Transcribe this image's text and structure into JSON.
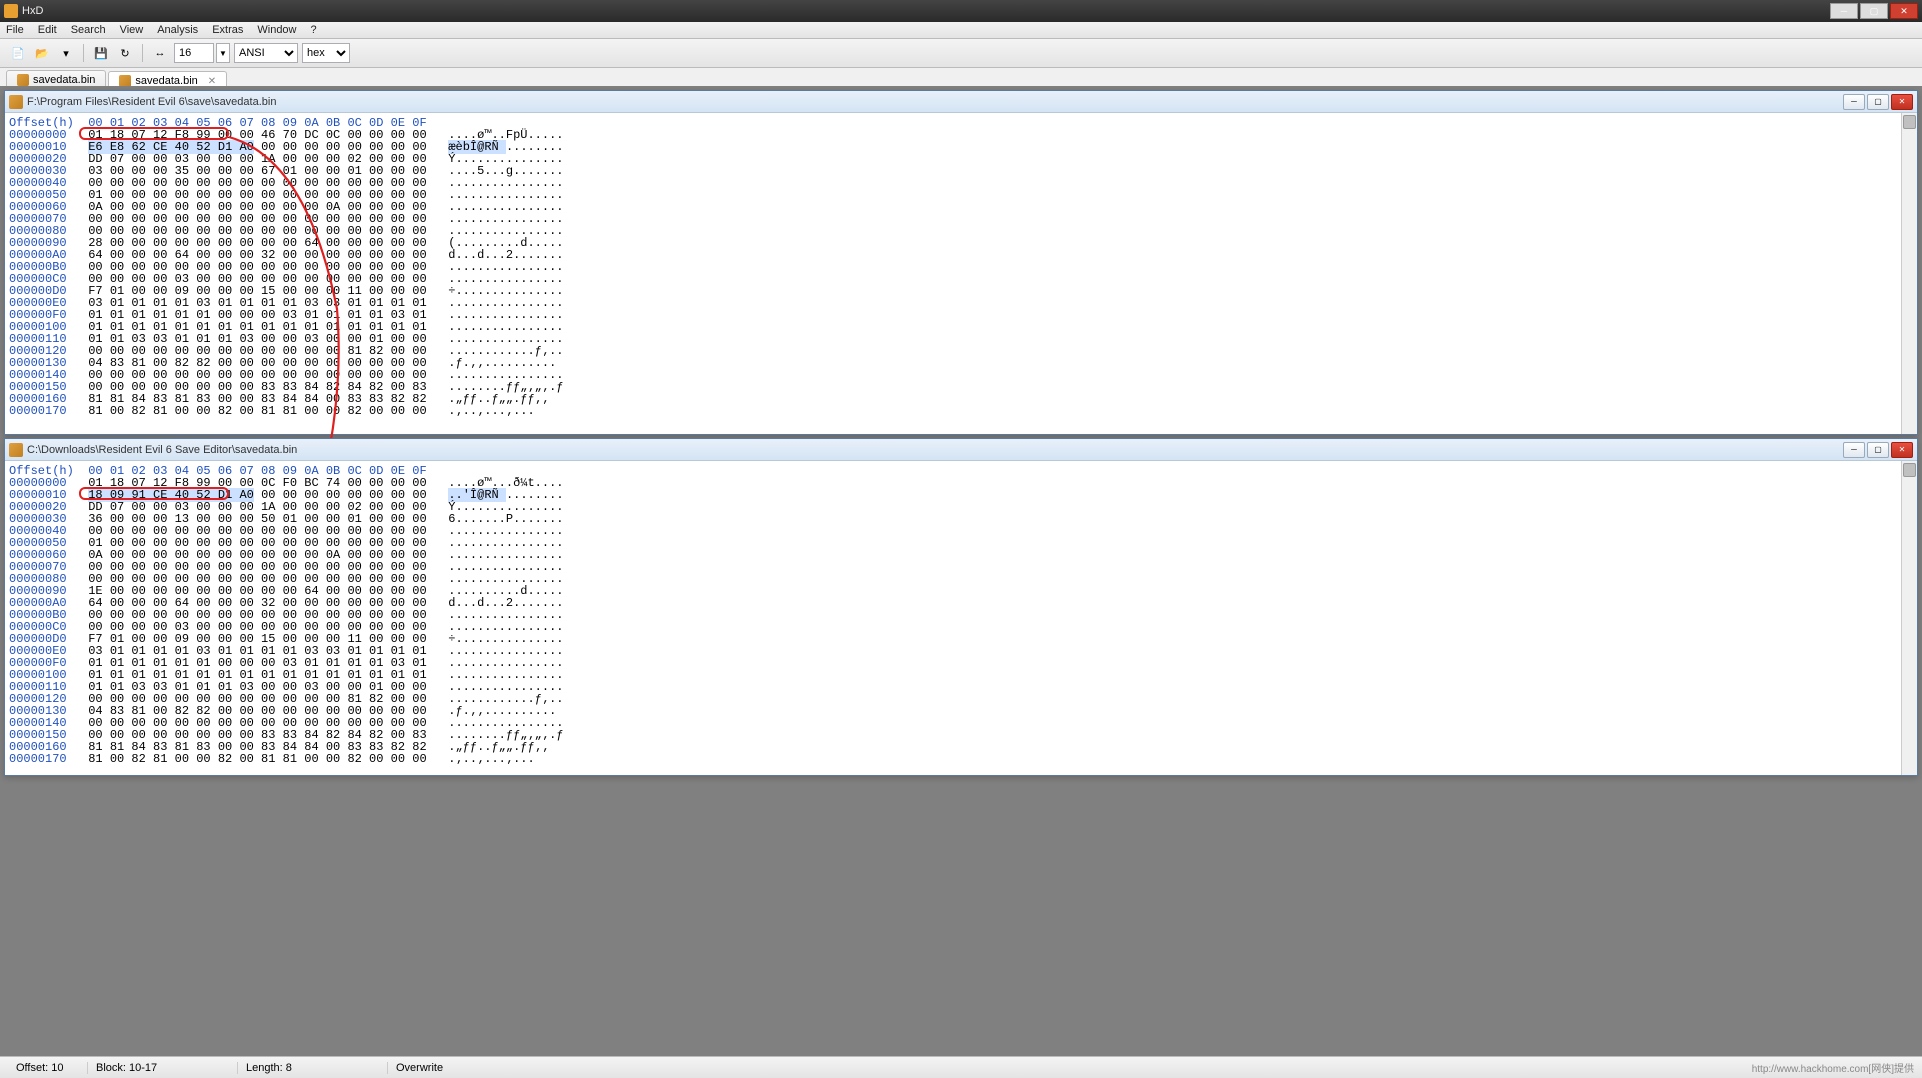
{
  "app_title": "HxD",
  "menu": [
    "File",
    "Edit",
    "Search",
    "View",
    "Analysis",
    "Extras",
    "Window",
    "?"
  ],
  "toolbar": {
    "cols_value": "16",
    "encoding_options": [
      "ANSI"
    ],
    "encoding_value": "ANSI",
    "base_options": [
      "hex"
    ],
    "base_value": "hex"
  },
  "tabs": [
    {
      "label": "savedata.bin",
      "active": false
    },
    {
      "label": "savedata.bin",
      "active": true
    }
  ],
  "panes": {
    "top": {
      "path": "F:\\Program Files\\Resident Evil 6\\save\\savedata.bin",
      "header": "Offset(h)  00 01 02 03 04 05 06 07 08 09 0A 0B 0C 0D 0E 0F",
      "selection": {
        "row": 1,
        "cols": [
          0,
          7
        ],
        "bytes": "E6 E8 62 CE 40 52 D1 A0",
        "ascii": "æèbÎ@RÑ "
      },
      "rows": [
        {
          "off": "00000000",
          "hex": "01 18 07 12 F8 99 00 00 46 70 DC 0C 00 00 00 00",
          "asc": "....ø™..FpÜ....."
        },
        {
          "off": "00000010",
          "hex": "E6 E8 62 CE 40 52 D1 A0 00 00 00 00 00 00 00 00",
          "asc": "æèbÎ@RÑ ........"
        },
        {
          "off": "00000020",
          "hex": "DD 07 00 00 03 00 00 00 1A 00 00 00 02 00 00 00",
          "asc": "Ý..............."
        },
        {
          "off": "00000030",
          "hex": "03 00 00 00 35 00 00 00 67 01 00 00 01 00 00 00",
          "asc": "....5...g......."
        },
        {
          "off": "00000040",
          "hex": "00 00 00 00 00 00 00 00 00 00 00 00 00 00 00 00",
          "asc": "................"
        },
        {
          "off": "00000050",
          "hex": "01 00 00 00 00 00 00 00 00 00 00 00 00 00 00 00",
          "asc": "................"
        },
        {
          "off": "00000060",
          "hex": "0A 00 00 00 00 00 00 00 00 00 00 0A 00 00 00 00",
          "asc": "................"
        },
        {
          "off": "00000070",
          "hex": "00 00 00 00 00 00 00 00 00 00 00 00 00 00 00 00",
          "asc": "................"
        },
        {
          "off": "00000080",
          "hex": "00 00 00 00 00 00 00 00 00 00 00 00 00 00 00 00",
          "asc": "................"
        },
        {
          "off": "00000090",
          "hex": "28 00 00 00 00 00 00 00 00 00 64 00 00 00 00 00",
          "asc": "(.........d....."
        },
        {
          "off": "000000A0",
          "hex": "64 00 00 00 64 00 00 00 32 00 00 00 00 00 00 00",
          "asc": "d...d...2......."
        },
        {
          "off": "000000B0",
          "hex": "00 00 00 00 00 00 00 00 00 00 00 00 00 00 00 00",
          "asc": "................"
        },
        {
          "off": "000000C0",
          "hex": "00 00 00 00 03 00 00 00 00 00 00 00 00 00 00 00",
          "asc": "................"
        },
        {
          "off": "000000D0",
          "hex": "F7 01 00 00 09 00 00 00 15 00 00 00 11 00 00 00",
          "asc": "÷..............."
        },
        {
          "off": "000000E0",
          "hex": "03 01 01 01 01 03 01 01 01 01 03 03 01 01 01 01",
          "asc": "................"
        },
        {
          "off": "000000F0",
          "hex": "01 01 01 01 01 01 00 00 00 03 01 01 01 01 03 01",
          "asc": "................"
        },
        {
          "off": "00000100",
          "hex": "01 01 01 01 01 01 01 01 01 01 01 01 01 01 01 01",
          "asc": "................"
        },
        {
          "off": "00000110",
          "hex": "01 01 03 03 01 01 01 03 00 00 03 00 00 01 00 00",
          "asc": "................"
        },
        {
          "off": "00000120",
          "hex": "00 00 00 00 00 00 00 00 00 00 00 00 81 82 00 00",
          "asc": "............ƒ‚.."
        },
        {
          "off": "00000130",
          "hex": "04 83 81 00 82 82 00 00 00 00 00 00 00 00 00 00",
          "asc": ".ƒ.‚‚.........."
        },
        {
          "off": "00000140",
          "hex": "00 00 00 00 00 00 00 00 00 00 00 00 00 00 00 00",
          "asc": "................"
        },
        {
          "off": "00000150",
          "hex": "00 00 00 00 00 00 00 00 83 83 84 82 84 82 00 83",
          "asc": "........ƒƒ„‚„‚.ƒ"
        },
        {
          "off": "00000160",
          "hex": "81 81 84 83 81 83 00 00 83 84 84 00 83 83 82 82",
          "asc": ".„ƒƒ..ƒ„„.ƒƒ‚‚"
        },
        {
          "off": "00000170",
          "hex": "81 00 82 81 00 00 82 00 81 81 00 00 82 00 00 00",
          "asc": ".‚..‚...‚..."
        }
      ]
    },
    "bottom": {
      "path": "C:\\Downloads\\Resident Evil 6 Save Editor\\savedata.bin",
      "header": "Offset(h)  00 01 02 03 04 05 06 07 08 09 0A 0B 0C 0D 0E 0F",
      "selection": {
        "row": 1,
        "cols": [
          0,
          7
        ],
        "bytes": "18 09 91 CE 40 52 D1 A0",
        "ascii": "..'Î@RÑ "
      },
      "rows": [
        {
          "off": "00000000",
          "hex": "01 18 07 12 F8 99 00 00 0C F0 BC 74 00 00 00 00",
          "asc": "....ø™...ð¼t...."
        },
        {
          "off": "00000010",
          "hex": "18 09 91 CE 40 52 D1 A0 00 00 00 00 00 00 00 00",
          "asc": "..'Î@RÑ ........"
        },
        {
          "off": "00000020",
          "hex": "DD 07 00 00 03 00 00 00 1A 00 00 00 02 00 00 00",
          "asc": "Ý..............."
        },
        {
          "off": "00000030",
          "hex": "36 00 00 00 13 00 00 00 50 01 00 00 01 00 00 00",
          "asc": "6.......P......."
        },
        {
          "off": "00000040",
          "hex": "00 00 00 00 00 00 00 00 00 00 00 00 00 00 00 00",
          "asc": "................"
        },
        {
          "off": "00000050",
          "hex": "01 00 00 00 00 00 00 00 00 00 00 00 00 00 00 00",
          "asc": "................"
        },
        {
          "off": "00000060",
          "hex": "0A 00 00 00 00 00 00 00 00 00 00 0A 00 00 00 00",
          "asc": "................"
        },
        {
          "off": "00000070",
          "hex": "00 00 00 00 00 00 00 00 00 00 00 00 00 00 00 00",
          "asc": "................"
        },
        {
          "off": "00000080",
          "hex": "00 00 00 00 00 00 00 00 00 00 00 00 00 00 00 00",
          "asc": "................"
        },
        {
          "off": "00000090",
          "hex": "1E 00 00 00 00 00 00 00 00 00 64 00 00 00 00 00",
          "asc": "..........d....."
        },
        {
          "off": "000000A0",
          "hex": "64 00 00 00 64 00 00 00 32 00 00 00 00 00 00 00",
          "asc": "d...d...2......."
        },
        {
          "off": "000000B0",
          "hex": "00 00 00 00 00 00 00 00 00 00 00 00 00 00 00 00",
          "asc": "................"
        },
        {
          "off": "000000C0",
          "hex": "00 00 00 00 03 00 00 00 00 00 00 00 00 00 00 00",
          "asc": "................"
        },
        {
          "off": "000000D0",
          "hex": "F7 01 00 00 09 00 00 00 15 00 00 00 11 00 00 00",
          "asc": "÷..............."
        },
        {
          "off": "000000E0",
          "hex": "03 01 01 01 01 03 01 01 01 01 03 03 01 01 01 01",
          "asc": "................"
        },
        {
          "off": "000000F0",
          "hex": "01 01 01 01 01 01 00 00 00 03 01 01 01 01 03 01",
          "asc": "................"
        },
        {
          "off": "00000100",
          "hex": "01 01 01 01 01 01 01 01 01 01 01 01 01 01 01 01",
          "asc": "................"
        },
        {
          "off": "00000110",
          "hex": "01 01 03 03 01 01 01 03 00 00 03 00 00 01 00 00",
          "asc": "................"
        },
        {
          "off": "00000120",
          "hex": "00 00 00 00 00 00 00 00 00 00 00 00 81 82 00 00",
          "asc": "............ƒ‚.."
        },
        {
          "off": "00000130",
          "hex": "04 83 81 00 82 82 00 00 00 00 00 00 00 00 00 00",
          "asc": ".ƒ.‚‚.........."
        },
        {
          "off": "00000140",
          "hex": "00 00 00 00 00 00 00 00 00 00 00 00 00 00 00 00",
          "asc": "................"
        },
        {
          "off": "00000150",
          "hex": "00 00 00 00 00 00 00 00 83 83 84 82 84 82 00 83",
          "asc": "........ƒƒ„‚„‚.ƒ"
        },
        {
          "off": "00000160",
          "hex": "81 81 84 83 81 83 00 00 83 84 84 00 83 83 82 82",
          "asc": ".„ƒƒ..ƒ„„.ƒƒ‚‚"
        },
        {
          "off": "00000170",
          "hex": "81 00 82 81 00 00 82 00 81 81 00 00 82 00 00 00",
          "asc": ".‚..‚...‚..."
        }
      ]
    }
  },
  "statusbar": {
    "offset_label": "Offset: 10",
    "block_label": "Block: 10-17",
    "length_label": "Length: 8",
    "mode_label": "Overwrite",
    "watermark": "http://www.hackhome.com[网侠]提供"
  }
}
